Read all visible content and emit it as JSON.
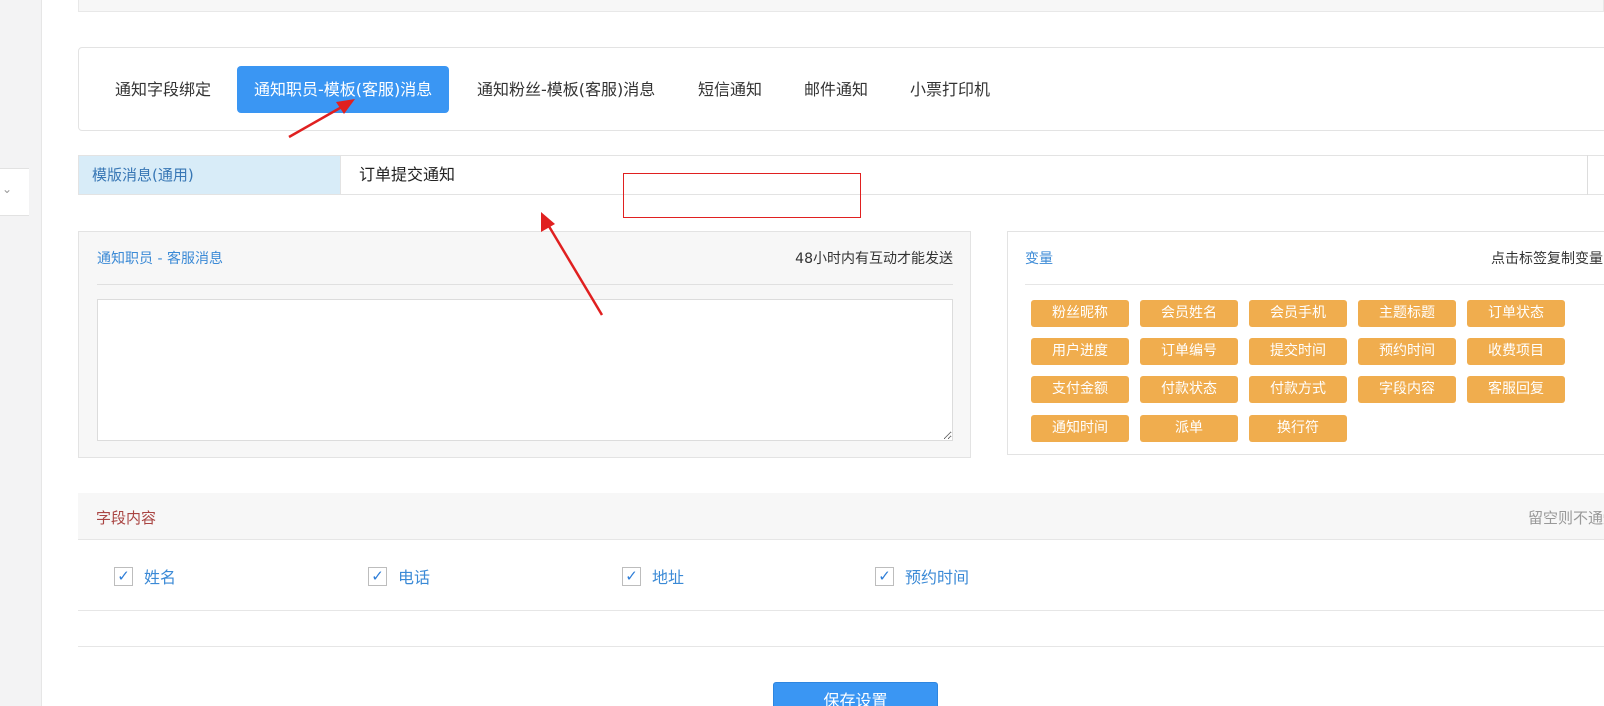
{
  "tabs": [
    {
      "label": "通知字段绑定"
    },
    {
      "label": "通知职员-模板(客服)消息",
      "active": true
    },
    {
      "label": "通知粉丝-模板(客服)消息"
    },
    {
      "label": "短信通知"
    },
    {
      "label": "邮件通知"
    },
    {
      "label": "小票打印机"
    }
  ],
  "template": {
    "label": "模版消息(通用)",
    "value": "订单提交通知"
  },
  "message": {
    "title": "通知职员 - 客服消息",
    "note": "48小时内有互动才能发送",
    "content": ""
  },
  "variables": {
    "title": "变量",
    "hint": "点击标签复制变量",
    "tags": [
      "粉丝昵称",
      "会员姓名",
      "会员手机",
      "主题标题",
      "订单状态",
      "用户进度",
      "订单编号",
      "提交时间",
      "预约时间",
      "收费项目",
      "支付金额",
      "付款状态",
      "付款方式",
      "字段内容",
      "客服回复",
      "通知时间",
      "派单",
      "换行符"
    ]
  },
  "fields": {
    "title": "字段内容",
    "hint": "留空则不通知字段内容",
    "items": [
      {
        "label": "姓名",
        "checked": true
      },
      {
        "label": "电话",
        "checked": true
      },
      {
        "label": "地址",
        "checked": true
      },
      {
        "label": "预约时间",
        "checked": true
      }
    ]
  },
  "save_label": "保存设置",
  "colors": {
    "primary": "#3a96f3",
    "tag": "#f0ad4e",
    "annotation": "#e02020"
  }
}
